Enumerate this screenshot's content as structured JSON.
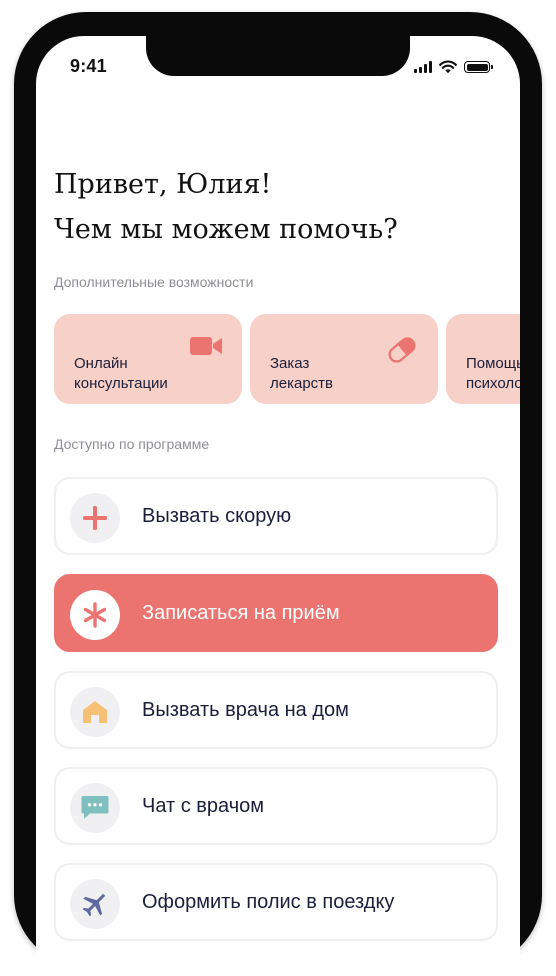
{
  "status_bar": {
    "time": "9:41"
  },
  "greeting": {
    "line1": "Привет, Юлия!",
    "line2": "Чем мы можем помочь?"
  },
  "extras": {
    "label": "Дополнительные возможности",
    "items": [
      {
        "label": "Онлайн\nконсультации",
        "icon": "video-camera-icon"
      },
      {
        "label": "Заказ\nлекарств",
        "icon": "pill-icon"
      },
      {
        "label": "Помощь\nпсихолога",
        "icon": "psychologist-icon"
      }
    ]
  },
  "program": {
    "label": "Доступно по программе",
    "actions": [
      {
        "label": "Вызвать скорую",
        "icon": "plus-icon"
      },
      {
        "label": "Записаться на приём",
        "icon": "asterisk-icon"
      },
      {
        "label": "Вызвать врача на дом",
        "icon": "house-icon"
      },
      {
        "label": "Чат с врачом",
        "icon": "chat-bubble-icon"
      },
      {
        "label": "Оформить полис в поездку",
        "icon": "airplane-icon"
      }
    ]
  },
  "colors": {
    "accent": "#ec7470",
    "card_pink": "#f7d0c8",
    "text_dark": "#1b1f3b",
    "house_orange": "#f6c177",
    "chat_teal": "#7fbfbf",
    "plane_blue": "#5c6aa0"
  }
}
